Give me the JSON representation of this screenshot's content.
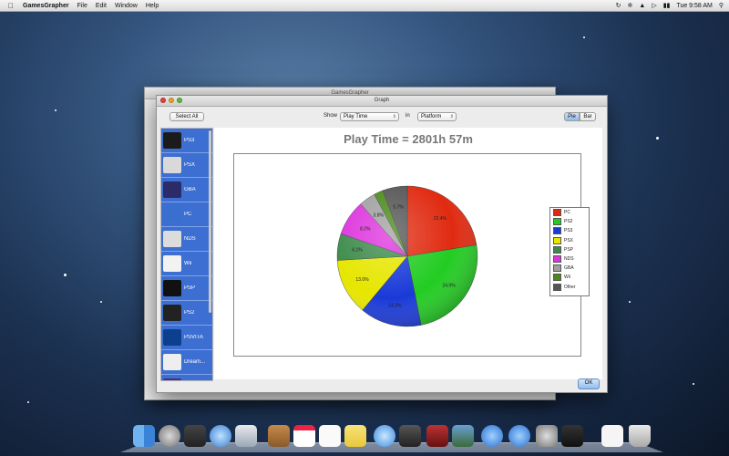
{
  "menubar": {
    "apple": "",
    "app_name": "GamesGrapher",
    "items": [
      "File",
      "Edit",
      "Window",
      "Help"
    ],
    "clock": "Tue 9:58 AM"
  },
  "back_window": {
    "title": "GamesGrapher"
  },
  "window": {
    "title": "Graph"
  },
  "toolbar": {
    "select_all": "Select All",
    "show_label": "Show",
    "show_value": "Play Time",
    "in_label": "in",
    "group_value": "Platform",
    "pie_label": "Pie",
    "bar_label": "Bar"
  },
  "sidebar": {
    "items": [
      {
        "label": "PS3"
      },
      {
        "label": "PSX"
      },
      {
        "label": "GBA"
      },
      {
        "label": "PC"
      },
      {
        "label": "NDS"
      },
      {
        "label": "Wii"
      },
      {
        "label": "PSP"
      },
      {
        "label": "PS2"
      },
      {
        "label": "PSVITA"
      },
      {
        "label": "Dream..."
      },
      {
        "label": "GameC..."
      }
    ]
  },
  "ok_label": "OK",
  "chart_data": {
    "type": "pie",
    "title": "Play Time = 2801h 57m",
    "legend_position": "right",
    "slices": [
      {
        "name": "PC",
        "value": 22.4,
        "color": "#e02a10"
      },
      {
        "name": "PS2",
        "value": 24.4,
        "color": "#22cc22"
      },
      {
        "name": "PS3",
        "value": 14.2,
        "color": "#1a3ad8"
      },
      {
        "name": "PSX",
        "value": 13.0,
        "color": "#e6e600"
      },
      {
        "name": "PSP",
        "value": 6.1,
        "color": "#3c8a4a"
      },
      {
        "name": "NDS",
        "value": 8.2,
        "color": "#dd33dd"
      },
      {
        "name": "GBA",
        "value": 3.8,
        "color": "#a0a0a0"
      },
      {
        "name": "Wii",
        "value": 2.1,
        "color": "#4a8a1a"
      },
      {
        "name": "Other",
        "value": 5.7,
        "color": "#555555"
      }
    ],
    "slice_labels": [
      "22.4%",
      "24.9%",
      "14.2%",
      "13.0%",
      "6.1%",
      "8.2%",
      "3.8%",
      "",
      "5.7%"
    ]
  }
}
